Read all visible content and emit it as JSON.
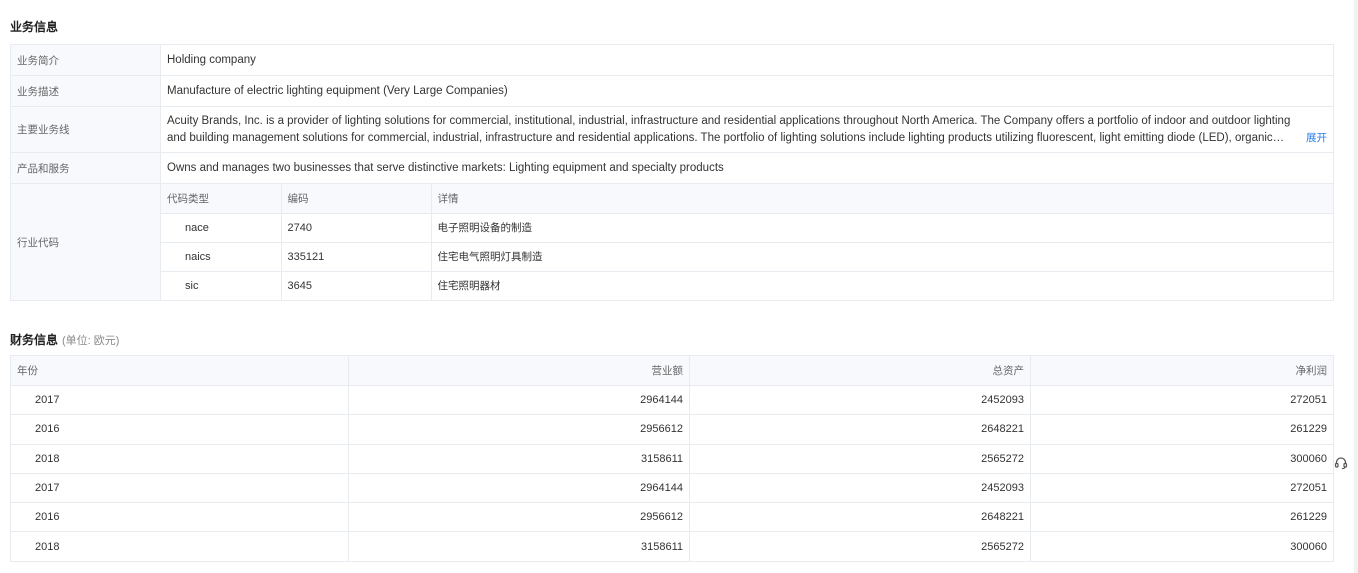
{
  "business": {
    "title": "业务信息",
    "rows": [
      {
        "label": "业务简介",
        "value": "Holding company"
      },
      {
        "label": "业务描述",
        "value": "Manufacture of electric lighting equipment (Very Large Companies)"
      },
      {
        "label": "主要业务线",
        "value": "Acuity Brands, Inc. is a provider of lighting solutions for commercial, institutional, industrial, infrastructure and residential applications throughout North America. The Company offers a portfolio of indoor and outdoor lighting and building management solutions for commercial, industrial, infrastructure and residential applications. The portfolio of lighting solutions include lighting products utilizing fluorescent, light emitting diode (LED), organic LE...",
        "expand_label": "展开"
      },
      {
        "label": "产品和服务",
        "value": "Owns and manages two businesses that serve distinctive markets: Lighting equipment and specialty products"
      }
    ],
    "industry": {
      "label": "行业代码",
      "headers": {
        "type": "代码类型",
        "code": "编码",
        "detail": "详情"
      },
      "rows": [
        {
          "type": "nace",
          "code": "2740",
          "detail": "电子照明设备的制造"
        },
        {
          "type": "naics",
          "code": "335121",
          "detail": "住宅电气照明灯具制造"
        },
        {
          "type": "sic",
          "code": "3645",
          "detail": "住宅照明器材"
        }
      ]
    }
  },
  "finance": {
    "title": "财务信息",
    "unit": "(单位: 欧元)",
    "headers": {
      "year": "年份",
      "revenue": "营业额",
      "assets": "总资产",
      "profit": "净利润"
    },
    "rows": [
      {
        "year": "2017",
        "revenue": "2964144",
        "assets": "2452093",
        "profit": "272051"
      },
      {
        "year": "2016",
        "revenue": "2956612",
        "assets": "2648221",
        "profit": "261229"
      },
      {
        "year": "2018",
        "revenue": "3158611",
        "assets": "2565272",
        "profit": "300060"
      },
      {
        "year": "2017",
        "revenue": "2964144",
        "assets": "2452093",
        "profit": "272051"
      },
      {
        "year": "2016",
        "revenue": "2956612",
        "assets": "2648221",
        "profit": "261229"
      },
      {
        "year": "2018",
        "revenue": "3158611",
        "assets": "2565272",
        "profit": "300060"
      }
    ]
  },
  "icons": {
    "support": "headset-icon"
  },
  "colors": {
    "link": "#2b7cf0",
    "label_bg": "#f7f9fc",
    "border": "#e8ecf1"
  }
}
